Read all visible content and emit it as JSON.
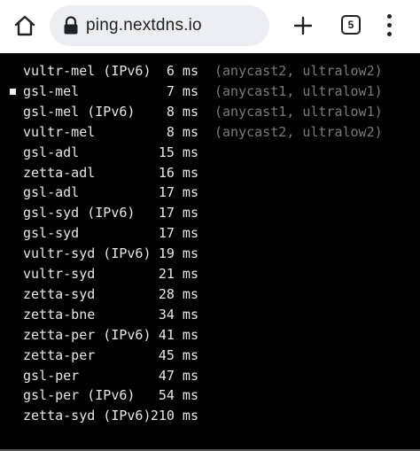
{
  "browser": {
    "url": "ping.nextdns.io",
    "tab_count": "5",
    "icons": {
      "home": "home-icon",
      "lock": "lock-icon",
      "new_tab": "plus-icon",
      "tabs": "tab-switcher-icon",
      "menu": "more-vert-icon"
    }
  },
  "results": [
    {
      "name": "vultr-mel (IPv6)",
      "latency": "6 ms",
      "note": "(anycast2, ultralow2)",
      "selected": false
    },
    {
      "name": "gsl-mel",
      "latency": "7 ms",
      "note": "(anycast1, ultralow1)",
      "selected": true
    },
    {
      "name": "gsl-mel (IPv6)",
      "latency": "8 ms",
      "note": "(anycast1, ultralow1)",
      "selected": false
    },
    {
      "name": "vultr-mel",
      "latency": "8 ms",
      "note": "(anycast2, ultralow2)",
      "selected": false
    },
    {
      "name": "gsl-adl",
      "latency": "15 ms",
      "note": "",
      "selected": false
    },
    {
      "name": "zetta-adl",
      "latency": "16 ms",
      "note": "",
      "selected": false
    },
    {
      "name": "gsl-adl",
      "latency": "17 ms",
      "note": "",
      "selected": false
    },
    {
      "name": "gsl-syd (IPv6)",
      "latency": "17 ms",
      "note": "",
      "selected": false
    },
    {
      "name": "gsl-syd",
      "latency": "17 ms",
      "note": "",
      "selected": false
    },
    {
      "name": "vultr-syd (IPv6)",
      "latency": "19 ms",
      "note": "",
      "selected": false
    },
    {
      "name": "vultr-syd",
      "latency": "21 ms",
      "note": "",
      "selected": false
    },
    {
      "name": "zetta-syd",
      "latency": "28 ms",
      "note": "",
      "selected": false
    },
    {
      "name": "zetta-bne",
      "latency": "34 ms",
      "note": "",
      "selected": false
    },
    {
      "name": "zetta-per (IPv6)",
      "latency": "41 ms",
      "note": "",
      "selected": false
    },
    {
      "name": "zetta-per",
      "latency": "45 ms",
      "note": "",
      "selected": false
    },
    {
      "name": "gsl-per",
      "latency": "47 ms",
      "note": "",
      "selected": false
    },
    {
      "name": "gsl-per (IPv6)",
      "latency": "54 ms",
      "note": "",
      "selected": false
    },
    {
      "name": "zetta-syd (IPv6)",
      "latency": "210 ms",
      "note": "",
      "selected": false
    }
  ],
  "colors": {
    "background": "#000000",
    "text": "#e8e8e8",
    "note": "#7a7a7a",
    "toolbar": "#ffffff",
    "urlbar": "#eceef2"
  }
}
